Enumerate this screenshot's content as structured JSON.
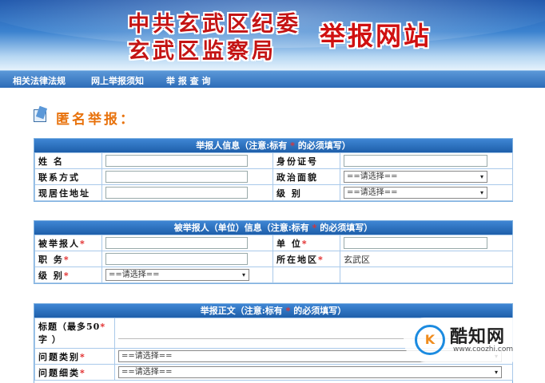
{
  "header": {
    "org_line1": "中共玄武区纪委",
    "org_line2": "玄武区监察局",
    "site_title": "举报网站"
  },
  "nav": {
    "items": [
      "相关法律法规",
      "网上举报须知",
      "举 报 查 询"
    ]
  },
  "section_title": "匿名举报：",
  "panel1": {
    "title_pre": "举报人信息（注意:标有",
    "title_star": "*",
    "title_post": "的必须填写）",
    "rows": [
      {
        "l1": "姓 名",
        "l2": "身份证号"
      },
      {
        "l1": "联系方式",
        "l2": "政治面貌",
        "select2": "==请选择=="
      },
      {
        "l1": "现居住地址",
        "l2": "级 别",
        "select2b": "==请选择=="
      }
    ]
  },
  "panel2": {
    "title_pre": "被举报人（单位）信息（注意:标有",
    "title_star": "*",
    "title_post": "的必须填写）",
    "l_name": "被举报人",
    "l_unit": "单 位",
    "l_post": "职 务",
    "l_area": "所在地区",
    "area_value": "玄武区",
    "l_level": "级 别",
    "level_select": "==请选择=="
  },
  "panel3": {
    "title_pre": "举报正文（注意:标有",
    "title_star": "*",
    "title_post": "的必须填写）",
    "l_subject_1": "标题（最多50",
    "l_subject_2": "字 ）",
    "l_type": "问题类别",
    "type_select": "==请选择==",
    "l_detail": "问题细类",
    "detail_select": "==请选择=="
  },
  "required_mark": "*",
  "select_arrow": "▾",
  "watermark": {
    "logo_text": "K",
    "name": "酷知网",
    "url": "www.coozhi.com"
  },
  "colors": {
    "accent_blue": "#2d6cb8",
    "title_orange": "#e8720c",
    "required_red": "#e02020",
    "banner_red": "#c41414"
  }
}
